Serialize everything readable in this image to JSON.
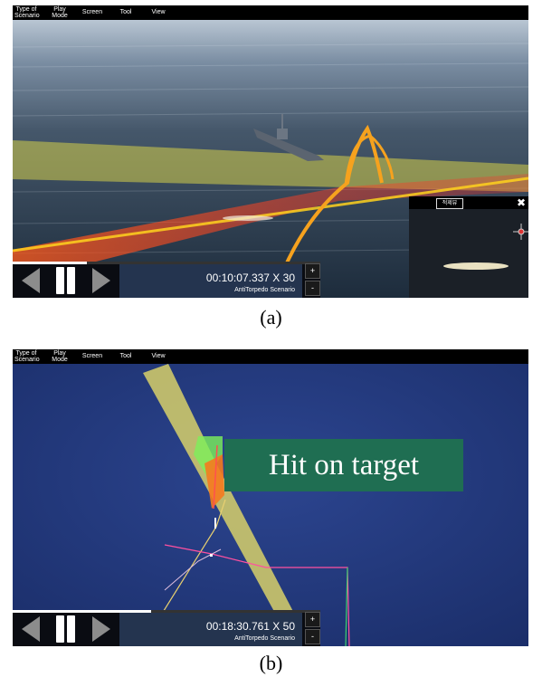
{
  "menu": [
    {
      "label": "Type of\nScenario"
    },
    {
      "label": "Play\nMode"
    },
    {
      "label": "Screen"
    },
    {
      "label": "Tool"
    },
    {
      "label": "View"
    }
  ],
  "panel_a": {
    "time": "00:10:07.337 X 30",
    "scenario": "AntiTorpedo Scenario",
    "progress": 0.24,
    "zoom_in": "+",
    "zoom_out": "-",
    "subview": {
      "tabs": [
        "",
        "적제뷰"
      ],
      "close": "✖"
    },
    "caption": "(a)"
  },
  "panel_b": {
    "time": "00:18:30.761 X 50",
    "scenario": "AntiTorpedo Scenario",
    "progress": 0.45,
    "zoom_in": "+",
    "zoom_out": "-",
    "banner": "Hit on target",
    "caption": "(b)"
  },
  "colors": {
    "sea_a": "#3d4c5a",
    "sea_b": "#23387a",
    "yellow_band": "#d6cf4a",
    "torpedo_track": "#f6a21e",
    "red_beam": "#ff3a2a",
    "banner_bg": "#1f6e52"
  }
}
